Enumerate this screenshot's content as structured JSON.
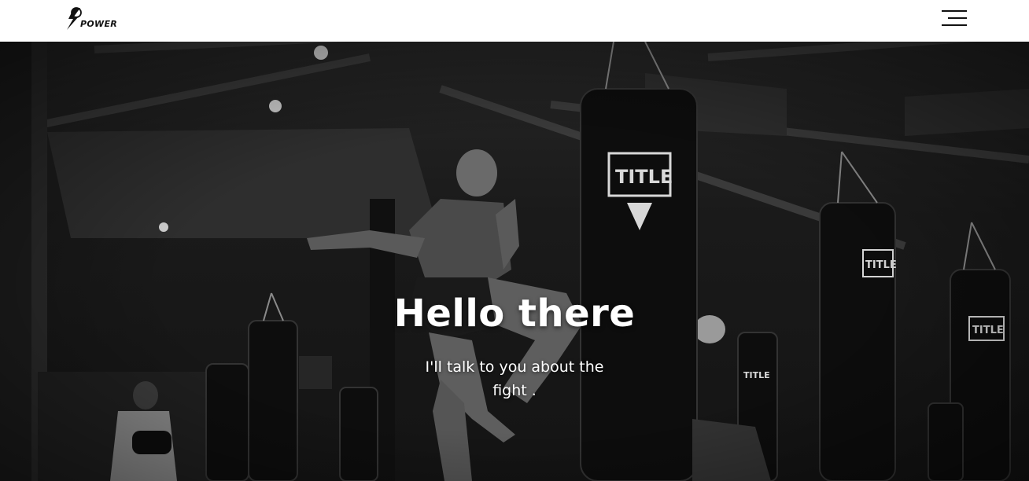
{
  "navbar": {
    "logo_text": "POWER"
  },
  "hero": {
    "title": "Hello there",
    "subtitle": "I'll talk to you about the fight ."
  }
}
